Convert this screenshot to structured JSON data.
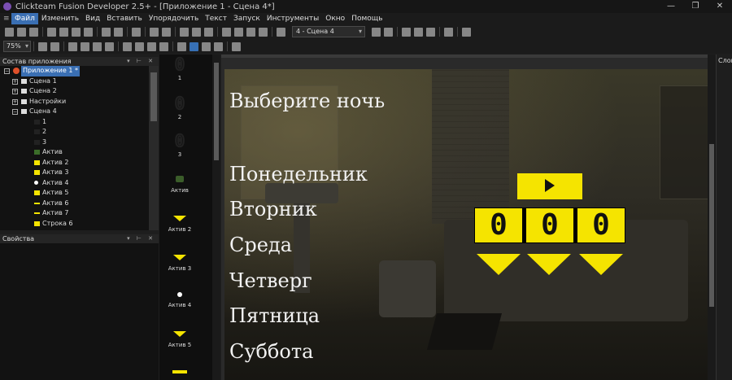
{
  "window": {
    "title": "Clickteam Fusion Developer 2.5+ - [Приложение 1 - Сцена 4*]",
    "controls": [
      "—",
      "❐",
      "✕"
    ]
  },
  "menu": [
    "Файл",
    "Изменить",
    "Вид",
    "Вставить",
    "Упорядочить",
    "Текст",
    "Запуск",
    "Инструменты",
    "Окно",
    "Помощь"
  ],
  "toolbar": {
    "scene_selector": "4 - Сцена 4",
    "zoom": "75%"
  },
  "workspace": {
    "title": "Состав приложения",
    "tree": [
      {
        "label": "Приложение 1 *",
        "level": 0,
        "selected": true
      },
      {
        "label": "Сцена 1",
        "level": 1
      },
      {
        "label": "Сцена 2",
        "level": 1
      },
      {
        "label": "Настройки",
        "level": 1
      },
      {
        "label": "Сцена 4",
        "level": 1
      },
      {
        "label": "1",
        "level": 2
      },
      {
        "label": "2",
        "level": 2
      },
      {
        "label": "3",
        "level": 2
      },
      {
        "label": "Актив",
        "level": 2
      },
      {
        "label": "Актив 2",
        "level": 2
      },
      {
        "label": "Актив 3",
        "level": 2
      },
      {
        "label": "Актив 4",
        "level": 2
      },
      {
        "label": "Актив 5",
        "level": 2
      },
      {
        "label": "Актив 6",
        "level": 2
      },
      {
        "label": "Актив 7",
        "level": 2
      },
      {
        "label": "Строка 6",
        "level": 2
      }
    ]
  },
  "properties": {
    "title": "Свойства"
  },
  "object_bar": [
    {
      "label": "1",
      "glyph": "0"
    },
    {
      "label": "2",
      "glyph": "0"
    },
    {
      "label": "3",
      "glyph": "0"
    },
    {
      "label": "Актив",
      "icon": "bug-icon"
    },
    {
      "label": "Актив 2",
      "icon": "triangle-icon"
    },
    {
      "label": "Актив 3",
      "icon": "triangle-icon"
    },
    {
      "label": "Актив 4",
      "icon": "dot-icon"
    },
    {
      "label": "Актив 5",
      "icon": "triangle-icon"
    }
  ],
  "scene": {
    "title": "Выберите ночь",
    "nights": [
      "Понедельник",
      "Вторник",
      "Среда",
      "Четверг",
      "Пятница",
      "Суббота"
    ],
    "digits": [
      "0",
      "0",
      "0"
    ]
  },
  "right_panel": {
    "label": "Слои"
  },
  "colors": {
    "accent": "#f5e400",
    "selection": "#3a6fb3"
  }
}
